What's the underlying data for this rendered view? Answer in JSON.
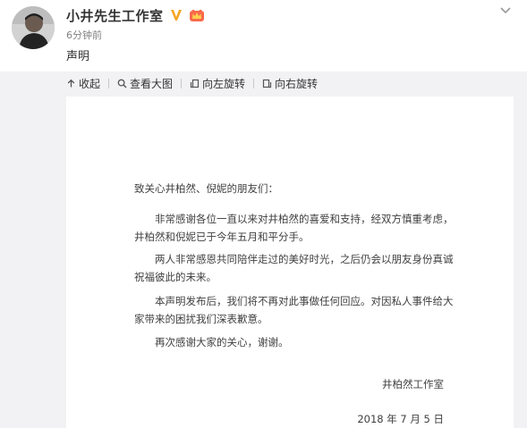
{
  "post": {
    "author": "小井先生工作室",
    "time": "6分钟前",
    "text": "声明"
  },
  "toolbar": {
    "collapse": "收起",
    "view_large": "查看大图",
    "rotate_left": "向左旋转",
    "rotate_right": "向右旋转"
  },
  "document": {
    "greeting": "致关心井柏然、倪妮的朋友们：",
    "paragraphs": [
      "非常感谢各位一直以来对井柏然的喜爱和支持，经双方慎重考虑，井柏然和倪妮已于今年五月和平分手。",
      "两人非常感恩共同陪伴走过的美好时光，之后仍会以朋友身份真诚祝福彼此的未来。",
      "本声明发布后，我们将不再对此事做任何回应。对因私人事件给大家带来的困扰我们深表歉意。",
      "再次感谢大家的关心，谢谢。"
    ],
    "signature": "井柏然工作室",
    "date": "2018 年 7 月 5 日"
  },
  "colors": {
    "verified_badge": "#f5a623",
    "vip_badge": "#f86a4b",
    "media_background": "#f2f2f5",
    "text_primary": "#333333",
    "text_secondary": "#808080"
  },
  "icons": {
    "verified": "verified-v-icon",
    "vip": "vip-crown-icon",
    "menu": "chevron-down-icon",
    "collapse": "collapse-up-arrow-icon",
    "view_large": "magnifier-icon",
    "rotate_left": "rotate-left-icon",
    "rotate_right": "rotate-right-icon"
  }
}
